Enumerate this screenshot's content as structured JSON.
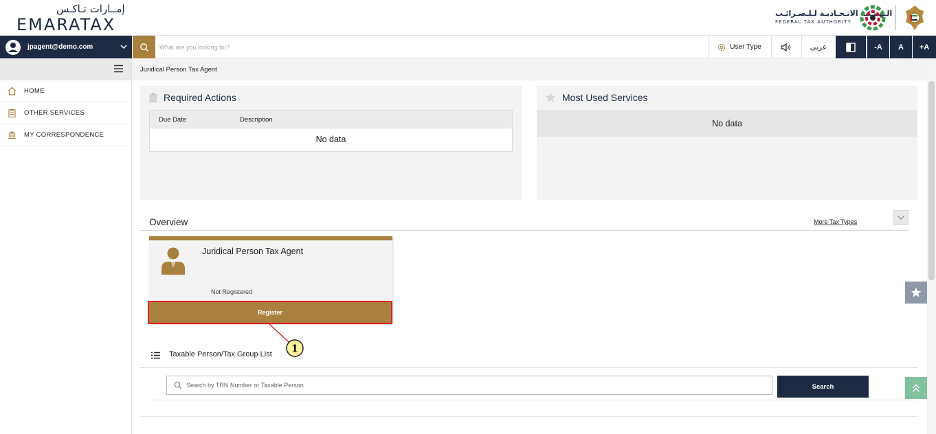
{
  "header": {
    "logo_ar": "إمــارات تـاكـس",
    "logo_en": "EMARATAX",
    "fta_name_ar": "الـهـيـئـة الاتـحـاديـة لـلـضـرائـب",
    "fta_name_en": "FEDERAL TAX AUTHORITY"
  },
  "toolbar": {
    "user_email": "jpagent@demo.com",
    "search_placeholder": "What are you looking for?",
    "user_type_label": "User Type",
    "language_label": "عربي",
    "font_decrease": "-A",
    "font_normal": "A",
    "font_increase": "+A"
  },
  "sidebar": {
    "items": [
      {
        "label": "HOME",
        "icon": "home-icon"
      },
      {
        "label": "OTHER SERVICES",
        "icon": "clipboard-icon"
      },
      {
        "label": "MY CORRESPONDENCE",
        "icon": "institution-icon"
      }
    ]
  },
  "breadcrumb": "Juridical Person Tax Agent",
  "required_actions": {
    "title": "Required Actions",
    "columns": [
      "Due Date",
      "Description"
    ],
    "empty_text": "No data"
  },
  "most_used_services": {
    "title": "Most Used Services",
    "empty_text": "No data"
  },
  "overview": {
    "title": "Overview",
    "more_link": "More Tax Types",
    "card": {
      "title": "Juridical Person Tax Agent",
      "status": "Not Registered",
      "register_label": "Register"
    },
    "callout_number": "1"
  },
  "taxable_list": {
    "title": "Taxable Person/Tax Group List",
    "search_placeholder": "Search by TRN Number or Taxable Person",
    "search_button": "Search"
  },
  "colors": {
    "navy": "#1e2a44",
    "gold": "#a9813e",
    "highlight_red": "#e02020",
    "fav_button": "#8f99ab",
    "top_button": "#7fc29b"
  }
}
